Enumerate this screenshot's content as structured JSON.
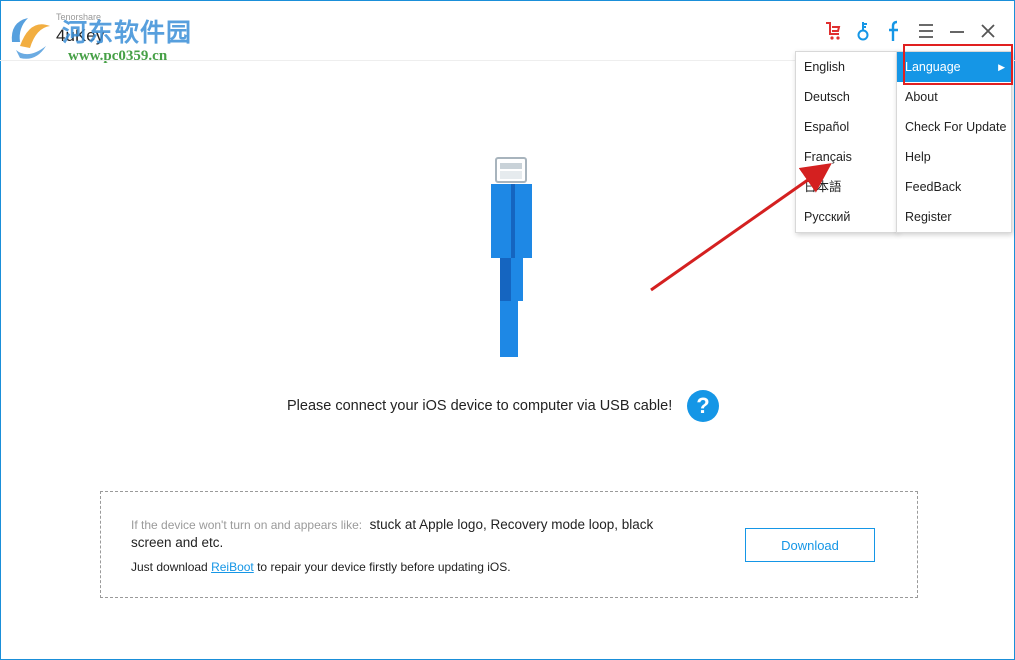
{
  "app": {
    "brand_small": "Tenorshare",
    "title": "4uKey",
    "watermark_cn": "河东软件园",
    "watermark_url": "www.pc0359.cn"
  },
  "titlebar_icons": [
    "cart-icon",
    "key-icon",
    "facebook-icon",
    "menu-icon",
    "minimize-icon",
    "close-icon"
  ],
  "main": {
    "connect_message": "Please connect your iOS device to computer via USB cable!",
    "help_label": "?"
  },
  "info_box": {
    "prefix": "If the device won't turn on and appears like:",
    "symptoms": "stuck at Apple logo, Recovery mode loop, black screen and etc.",
    "line2_before": "Just download ",
    "link_text": "ReiBoot",
    "line2_after": " to repair your device firstly before updating iOS.",
    "download_label": "Download"
  },
  "language_menu": {
    "items": [
      "English",
      "Deutsch",
      "Español",
      "Français",
      "日本語",
      "Русский"
    ]
  },
  "main_menu": {
    "items": [
      "Language",
      "About",
      "Check For Update",
      "Help",
      "FeedBack",
      "Register"
    ],
    "active": "Language",
    "submenu_arrow": "▶"
  },
  "colors": {
    "accent": "#1596e6",
    "frame": "#1a8fd9",
    "annotation": "#e02020",
    "cable_blue": "#1e88e5"
  }
}
